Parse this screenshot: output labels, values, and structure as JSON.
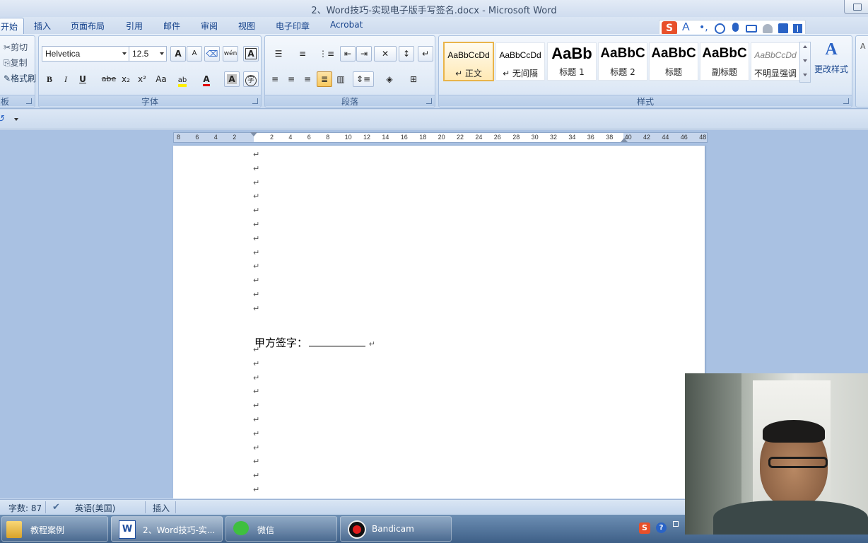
{
  "window": {
    "title": "2、Word技巧-实现电子版手写签名.docx - Microsoft Word"
  },
  "ribbon_tabs": [
    {
      "label": "开始",
      "active": true
    },
    {
      "label": "插入"
    },
    {
      "label": "页面布局"
    },
    {
      "label": "引用"
    },
    {
      "label": "邮件"
    },
    {
      "label": "审阅"
    },
    {
      "label": "视图"
    },
    {
      "label": "电子印章"
    },
    {
      "label": "Acrobat"
    }
  ],
  "clipboard": {
    "cut": "剪切",
    "copy": "复制",
    "format_painter": "格式刷",
    "label": "板"
  },
  "font_group": {
    "font_name": "Helvetica",
    "font_size": "12.5",
    "label": "字体",
    "bold": "B",
    "italic": "I",
    "underline": "U",
    "strike": "abe",
    "subscript": "x₂",
    "superscript": "x²",
    "change_case": "Aa",
    "grow": "A",
    "shrink": "A",
    "phonetic": "A",
    "font_color": "A",
    "char_shading": "A",
    "highlight_label": "ab",
    "pinyin": "wén"
  },
  "paragraph_group": {
    "label": "段落"
  },
  "styles_group": {
    "label": "样式",
    "change_styles": "更改样式",
    "items": [
      {
        "sample": "AaBbCcDd",
        "name": "↵ 正文",
        "active": true
      },
      {
        "sample": "AaBbCcDd",
        "name": "↵ 无间隔"
      },
      {
        "sample": "AaBb",
        "name": "标题 1"
      },
      {
        "sample": "AaBbC",
        "name": "标题 2"
      },
      {
        "sample": "AaBbC",
        "name": "标题"
      },
      {
        "sample": "AaBbC",
        "name": "副标题"
      },
      {
        "sample": "AaBbCcDd",
        "name": "不明显强调"
      }
    ]
  },
  "ruler": {
    "ticks": [
      "8",
      "6",
      "4",
      "2",
      "",
      "2",
      "4",
      "6",
      "8",
      "10",
      "12",
      "14",
      "16",
      "18",
      "20",
      "22",
      "24",
      "26",
      "28",
      "30",
      "32",
      "34",
      "36",
      "38",
      "40",
      "42",
      "44",
      "46",
      "48"
    ]
  },
  "document": {
    "paragraph_mark": "↵",
    "signature_label": "甲方签字："
  },
  "status_bar": {
    "word_count": "字数: 87",
    "language": "英语(美国)",
    "mode": "插入"
  },
  "taskbar": {
    "items": [
      {
        "label": "教程案例"
      },
      {
        "label": "2、Word技巧-实..."
      },
      {
        "label": "微信"
      },
      {
        "label": "Bandicam"
      }
    ]
  },
  "colors": {
    "ribbon_bg": "#d4e2f3",
    "accent": "#15428b",
    "active_style_border": "#e9b44a",
    "taskbar": "#3e5f87"
  }
}
